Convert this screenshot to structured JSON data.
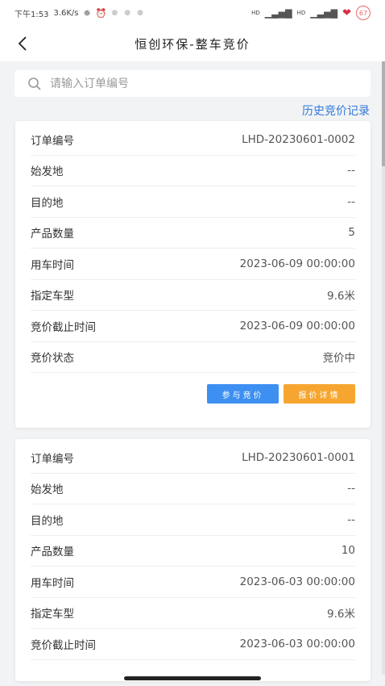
{
  "status_bar": {
    "time": "下午1:53",
    "network_speed": "3.6K/s",
    "signal_1": "HD",
    "signal_2": "HD",
    "battery": "67"
  },
  "nav": {
    "title": "恒创环保-整车竞价"
  },
  "search": {
    "placeholder": "请输入订单编号",
    "value": ""
  },
  "history_link": "历史竞价记录",
  "labels": {
    "order_no": "订单编号",
    "origin": "始发地",
    "destination": "目的地",
    "quantity": "产品数量",
    "use_time": "用车时间",
    "vehicle_type": "指定车型",
    "deadline": "竞价截止时间",
    "status": "竞价状态"
  },
  "orders": [
    {
      "order_no": "LHD-20230601-0002",
      "origin": "--",
      "destination": "--",
      "quantity": "5",
      "use_time": "2023-06-09 00:00:00",
      "vehicle_type": "9.6米",
      "deadline": "2023-06-09 00:00:00",
      "status": "竞价中",
      "join_button": "参与竞价",
      "detail_button": "报价详情"
    },
    {
      "order_no": "LHD-20230601-0001",
      "origin": "--",
      "destination": "--",
      "quantity": "10",
      "use_time": "2023-06-03 00:00:00",
      "vehicle_type": "9.6米",
      "deadline": "2023-06-03 00:00:00"
    }
  ],
  "colors": {
    "primary_blue": "#3d8ff2",
    "accent_orange": "#f6a630",
    "link_blue": "#2f79d8",
    "background": "#f2f3f5"
  }
}
